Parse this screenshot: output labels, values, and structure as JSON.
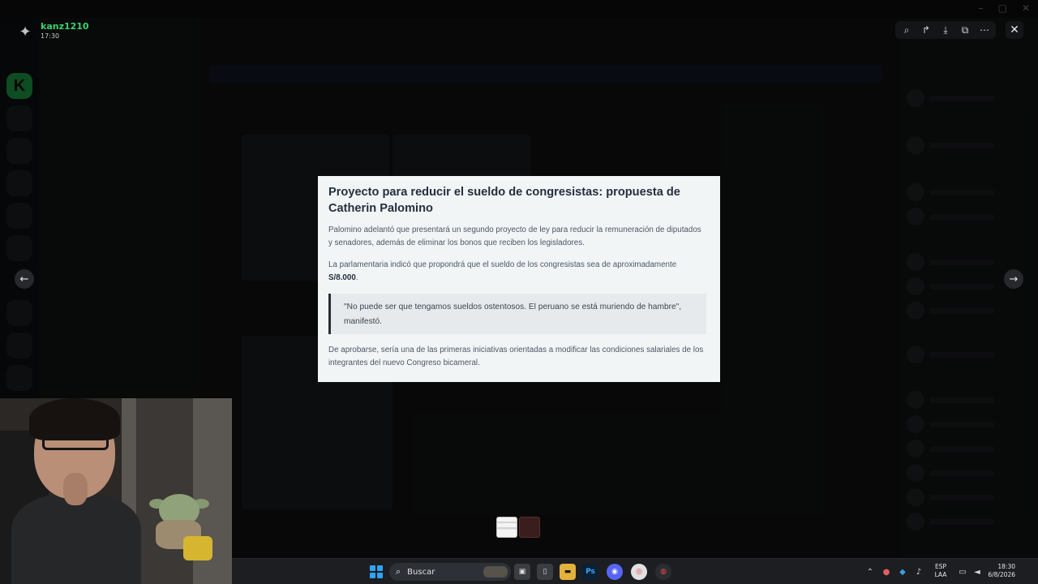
{
  "user": {
    "name": "kanz1210",
    "time": "17:30"
  },
  "toolbar": {
    "zoom_icon": "⌕",
    "forward_icon": "↱",
    "download_icon": "⤓",
    "open_icon": "⧉",
    "more_icon": "⋯",
    "close_icon": "✕"
  },
  "nav": {
    "prev_icon": "←",
    "next_icon": "→"
  },
  "article": {
    "title": "Proyecto para reducir el sueldo de congresistas: propuesta de Catherin Palomino",
    "p1": "Palomino adelantó que presentará un segundo proyecto de ley para reducir la remuneración de diputados y senadores, además de eliminar los bonos que reciben los legisladores.",
    "p2_text": "La parlamentaria indicó que propondrá que el sueldo de los congresistas sea de aproximadamente ",
    "p2_bold": "S/8.000",
    "p2_end": ".",
    "quote": "\"No puede ser que tengamos sueldos ostentosos. El peruano se está muriendo de hambre\", manifestó.",
    "p3": "De aprobarse, sería una de las primeras iniciativas orientadas a modificar las condiciones salariales de los integrantes del nuevo Congreso bicameral."
  },
  "taskbar": {
    "search_placeholder": "Buscar",
    "lang_line1": "ESP",
    "lang_line2": "LAA",
    "clock_time": "18:30",
    "clock_date": "6/8/2026",
    "app_ps": "Ps"
  },
  "colors": {
    "accent_green": "#3bd16f",
    "windows_blue": "#2ea4f5",
    "article_bg": "#f2f5f6"
  }
}
